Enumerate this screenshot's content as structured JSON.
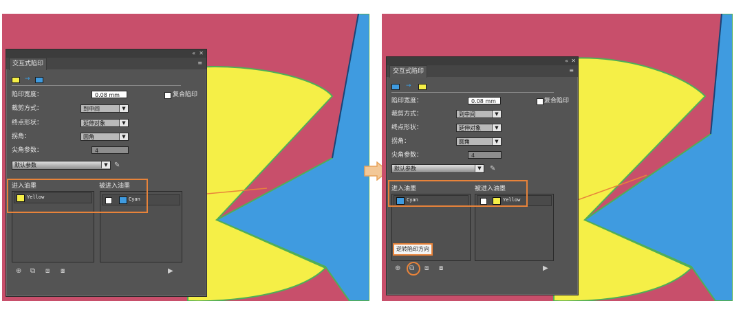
{
  "colors": {
    "background_red": "#c84f6b",
    "shape_yellow": "#f5ef47",
    "shape_blue": "#3f9be0",
    "outline_green": "#4fae57",
    "highlight_orange": "#e8833a",
    "panel_gray": "#545454"
  },
  "before": {
    "panel": {
      "collapse_icon": "«",
      "close_icon": "✕",
      "tab_label": "交互式陷印",
      "menu_icon": "≡",
      "trap_width_label": "陷印宽度：",
      "trap_width_value": "0.08 mm",
      "overprint_label": "复合陷印",
      "cut_style_label": "裁剪方式：",
      "cut_style_value": "到中间",
      "end_shape_label": "终点形状：",
      "end_shape_value": "延伸对象",
      "corner_label": "拐角：",
      "corner_value": "圆角",
      "miter_label": "尖角参数：",
      "miter_value": "4",
      "preset_value": "默认参数",
      "enter_ink_label": "进入油墨",
      "entered_ink_label": "被进入油墨",
      "enter_ink_item": "Yellow",
      "entered_ink_item": "Cyan",
      "swatch_from": "yellow",
      "swatch_to": "blue"
    }
  },
  "after": {
    "panel": {
      "collapse_icon": "«",
      "close_icon": "✕",
      "tab_label": "交互式陷印",
      "menu_icon": "≡",
      "trap_width_label": "陷印宽度：",
      "trap_width_value": "0.08 mm",
      "overprint_label": "复合陷印",
      "cut_style_label": "裁剪方式：",
      "cut_style_value": "到中间",
      "end_shape_label": "终点形状：",
      "end_shape_value": "延伸对象",
      "corner_label": "拐角：",
      "corner_value": "圆角",
      "miter_label": "尖角参数：",
      "miter_value": "4",
      "preset_value": "默认参数",
      "enter_ink_label": "进入油墨",
      "entered_ink_label": "被进入油墨",
      "enter_ink_item": "Cyan",
      "entered_ink_item": "Yellow",
      "swatch_from": "blue",
      "swatch_to": "yellow",
      "tooltip": "逆转陷印方向"
    }
  }
}
